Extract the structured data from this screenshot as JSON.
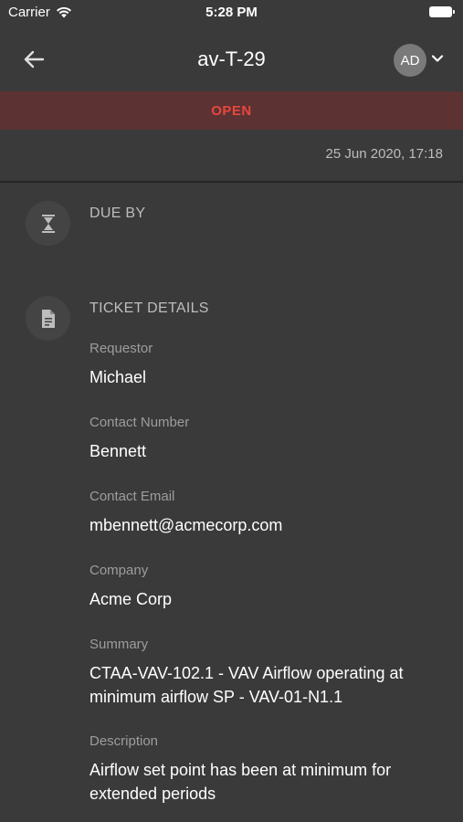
{
  "status_bar": {
    "carrier": "Carrier",
    "time": "5:28 PM"
  },
  "nav": {
    "title": "av-T-29",
    "avatar_initials": "AD"
  },
  "ticket_status": "OPEN",
  "date": "25 Jun 2020, 17:18",
  "due_section": {
    "title": "DUE BY",
    "icon": "hourglass-icon"
  },
  "details_section": {
    "title": "TICKET DETAILS",
    "icon": "document-icon",
    "fields": [
      {
        "label": "Requestor",
        "value": "Michael"
      },
      {
        "label": "Contact Number",
        "value": "Bennett"
      },
      {
        "label": "Contact Email",
        "value": "mbennett@acmecorp.com"
      },
      {
        "label": "Company",
        "value": "Acme Corp"
      },
      {
        "label": "Summary",
        "value": "CTAA-VAV-102.1 - VAV Airflow operating at minimum airflow SP - VAV-01-N1.1"
      },
      {
        "label": "Description",
        "value": "Airflow set point has been at minimum for extended periods"
      }
    ]
  },
  "colors": {
    "status_open": "#e8473f",
    "banner_bg": "#5c3232",
    "background": "#3a3a3a"
  }
}
